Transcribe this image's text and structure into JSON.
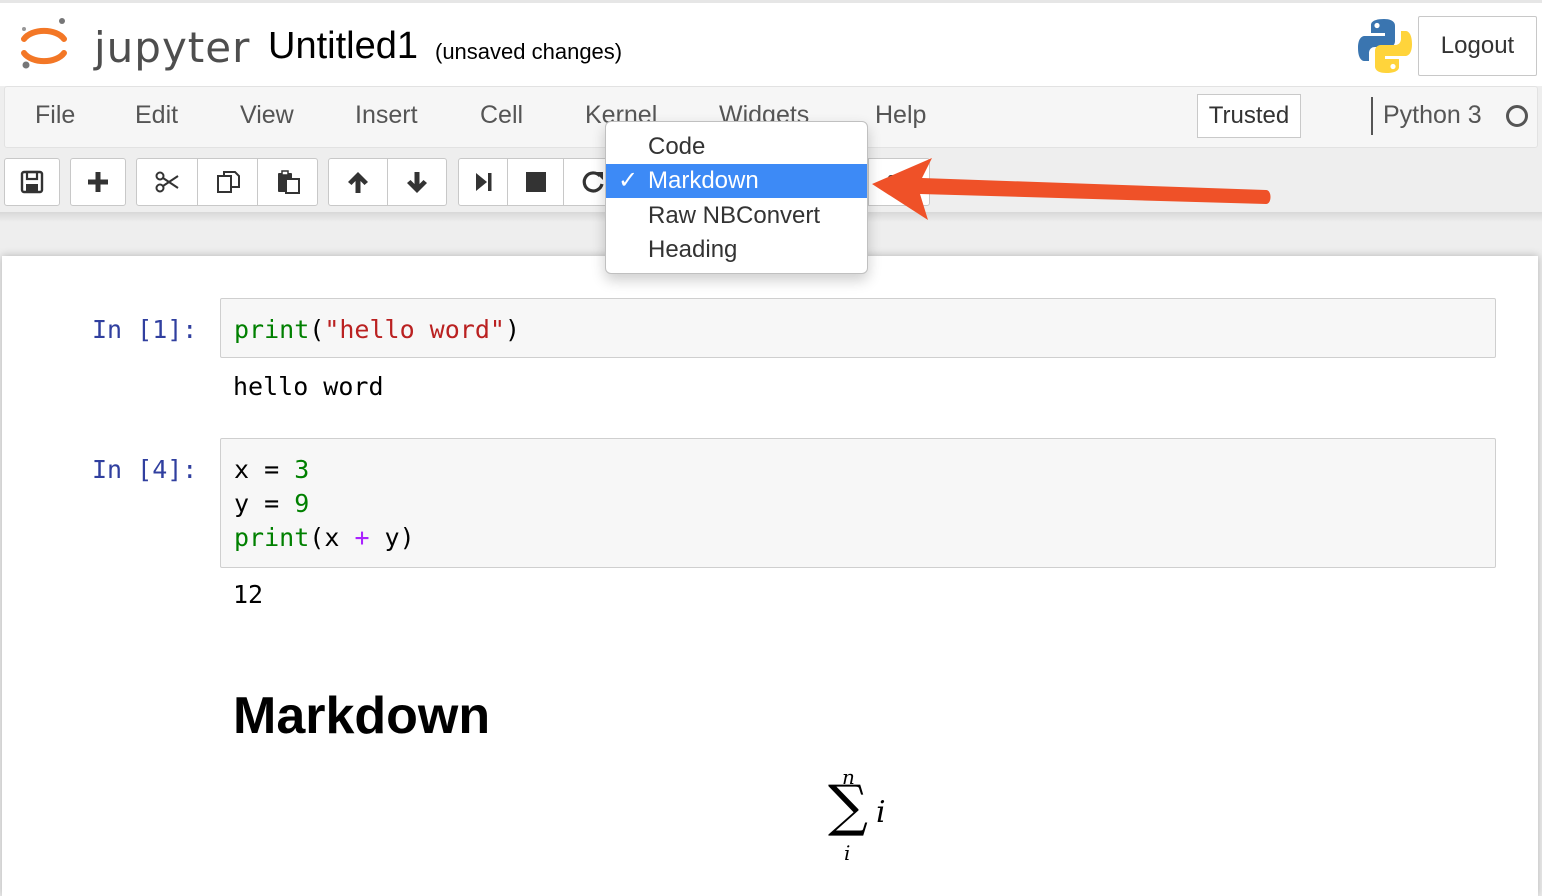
{
  "header": {
    "logo_text": "jupyter",
    "notebook_title": "Untitled1",
    "save_status": "(unsaved changes)",
    "logout_label": "Logout"
  },
  "menubar": {
    "items": [
      "File",
      "Edit",
      "View",
      "Insert",
      "Cell",
      "Kernel",
      "Widgets",
      "Help"
    ],
    "trusted_label": "Trusted",
    "kernel_name": "Python 3"
  },
  "toolbar": {
    "buttons": [
      "save-icon",
      "plus-icon",
      "scissors-icon",
      "copy-icon",
      "paste-icon",
      "arrow-up-icon",
      "arrow-down-icon",
      "step-forward-icon",
      "stop-icon",
      "restart-icon"
    ]
  },
  "cell_type_dropdown": {
    "options": [
      "Code",
      "Markdown",
      "Raw NBConvert",
      "Heading"
    ],
    "selected": "Markdown",
    "check_mark": "✓"
  },
  "cells": [
    {
      "prompt": "In [1]:",
      "code": [
        [
          {
            "t": "print",
            "c": "builtin"
          },
          {
            "t": "(",
            "c": "punct"
          },
          {
            "t": "\"hello word\"",
            "c": "string"
          },
          {
            "t": ")",
            "c": "punct"
          }
        ]
      ],
      "output": "hello word"
    },
    {
      "prompt": "In [4]:",
      "code": [
        [
          {
            "t": "x",
            "c": "variable"
          },
          {
            "t": " = ",
            "c": "punct"
          },
          {
            "t": "3",
            "c": "number"
          }
        ],
        [
          {
            "t": "y",
            "c": "variable"
          },
          {
            "t": " = ",
            "c": "punct"
          },
          {
            "t": "9",
            "c": "number"
          }
        ],
        [
          {
            "t": "print",
            "c": "builtin"
          },
          {
            "t": "(",
            "c": "punct"
          },
          {
            "t": "x",
            "c": "variable"
          },
          {
            "t": " + ",
            "c": "operator"
          },
          {
            "t": "y",
            "c": "variable"
          },
          {
            "t": ")",
            "c": "punct"
          }
        ]
      ],
      "output": "12"
    }
  ],
  "markdown": {
    "heading": "Markdown",
    "math_upper": "n",
    "math_operator": "∑",
    "math_lower": "i",
    "math_body": "i"
  },
  "colors": {
    "prompt": "#303f9f",
    "selected_bg": "#3d8af6",
    "annotation_arrow": "#ef5128"
  }
}
